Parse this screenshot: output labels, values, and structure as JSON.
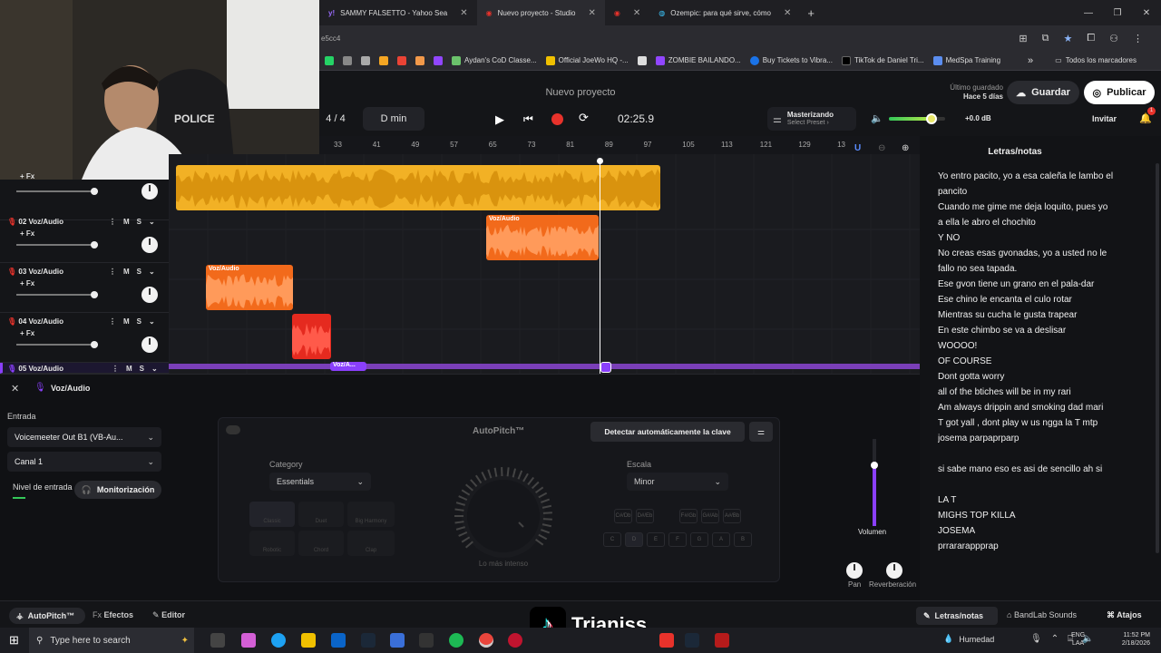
{
  "browser": {
    "tabs": [
      {
        "title": "SAMMY FALSETTO - Yahoo Sea",
        "active": false
      },
      {
        "title": "Nuevo proyecto - Studio",
        "active": true
      },
      {
        "title": "",
        "active": false
      },
      {
        "title": "Ozempic: para qué sirve, cómo",
        "active": false
      }
    ],
    "new_tab": "+",
    "address_fragment": "e5cc4",
    "bookmarks": [
      "Aydan's CoD Classe...",
      "Official JoeWo HQ -...",
      "ZOMBIE BAILANDO...",
      "Buy Tickets to Vibra...",
      "TikTok de Daniel Tri...",
      "MedSpa Training"
    ],
    "bookmarks_more": "»",
    "all_bookmarks": "Todos los marcadores"
  },
  "header": {
    "project_title": "Nuevo proyecto",
    "last_saved_label": "Último guardado",
    "last_saved_time": "Hace 5 días",
    "save_label": "Guardar",
    "publish_label": "Publicar",
    "invite_label": "Invitar",
    "notification_count": "1"
  },
  "transport": {
    "time_signature_num": "4",
    "time_signature_sep": "/",
    "time_signature_den": "4",
    "key": "D min",
    "time": "02:25.9",
    "mastering_title": "Masterizando",
    "mastering_sub": "Select Preset ›",
    "master_volume": "+0.0 dB",
    "volume_level": 0.75
  },
  "ruler": [
    "33",
    "41",
    "49",
    "57",
    "65",
    "73",
    "81",
    "89",
    "97",
    "105",
    "113",
    "121",
    "129",
    "13"
  ],
  "tracks": [
    {
      "name": "",
      "fx": "+ Fx"
    },
    {
      "name": "02 Voz/Audio",
      "fx": "+ Fx"
    },
    {
      "name": "03 Voz/Audio",
      "fx": "+ Fx"
    },
    {
      "name": "04 Voz/Audio",
      "fx": "+ Fx"
    },
    {
      "name": "05 Voz/Audio",
      "fx": ""
    }
  ],
  "mute_label": "M",
  "solo_label": "S",
  "clips": {
    "clip2_label": "Voz/Audio",
    "clip3_label": "Voz/Audio",
    "clip5_label": "Voz/A..."
  },
  "lyrics": {
    "title": "Letras/notas",
    "lines": [
      "Yo entro pacito, yo a esa caleña le lambo el",
      "pancito",
      "Cuando me gime me deja loquito, pues yo",
      "a ella le abro el chochito",
      "Y NO",
      "No creas esas gvonadas, yo a usted no le",
      "fallo no sea tapada.",
      "Ese gvon tiene un grano en el pala-dar",
      "Ese chino le encanta el culo rotar",
      "Mientras su cucha le gusta trapear",
      "En este chimbo se va a deslisar",
      "WOOOO!",
      "OF COURSE",
      "Dont gotta worry",
      "all of the btiches will be in my rari",
      "Am always drippin and smoking dad mari",
      "T got yall , dont play w us ngga la T mtp",
      "josema parpaprparp",
      "",
      "si sabe mano eso es asi de sencillo ah si",
      "",
      "LA T",
      "MIGHS TOP KILLA",
      "JOSEMA",
      "prrararappprap"
    ]
  },
  "panel": {
    "track_title": "Voz/Audio",
    "input_label": "Entrada",
    "input_device": "Voicemeeter Out B1 (VB-Au...",
    "channel": "Canal 1",
    "input_level_label": "Nivel de entrada",
    "monitor_label": "Monitorización",
    "plugin_title": "AutoPitch™",
    "detect_key": "Detectar automáticamente la clave",
    "category_label": "Category",
    "category_value": "Essentials",
    "scale_label": "Escala",
    "scale_value": "Minor",
    "presets": [
      "Classic",
      "Duet",
      "Big Harmony",
      "Robotic",
      "Chord",
      "Clap"
    ],
    "knob_caption": "Lo más intenso",
    "notes": [
      "C",
      "D",
      "E",
      "F",
      "G",
      "A",
      "B"
    ],
    "sharps": [
      "C#/Db",
      "D#/Eb",
      "F#/Gb",
      "G#/Ab",
      "A#/Bb"
    ],
    "volume_label": "Volumen",
    "pan_label": "Pan",
    "reverb_label": "Reverberación"
  },
  "bottom_tabs": {
    "autopitch": "AutoPitch™",
    "effects": "Efectos",
    "editor": "Editor",
    "lyrics": "Letras/notas",
    "sounds": "BandLab Sounds",
    "shortcuts": "Atajos"
  },
  "watermark": "Trianiss",
  "taskbar": {
    "search_placeholder": "Type here to search",
    "weather": "Humedad",
    "lang1": "ENG",
    "lang2": "LAA",
    "time": "11:52 PM",
    "date": "2/18/2026"
  },
  "colors": {
    "accent_purple": "#8a3ffc",
    "clip_yellow": "#f2b125",
    "clip_orange": "#f26a1b",
    "clip_red": "#e52a1f",
    "record_red": "#e8322b",
    "volume_green": "#34c759"
  }
}
